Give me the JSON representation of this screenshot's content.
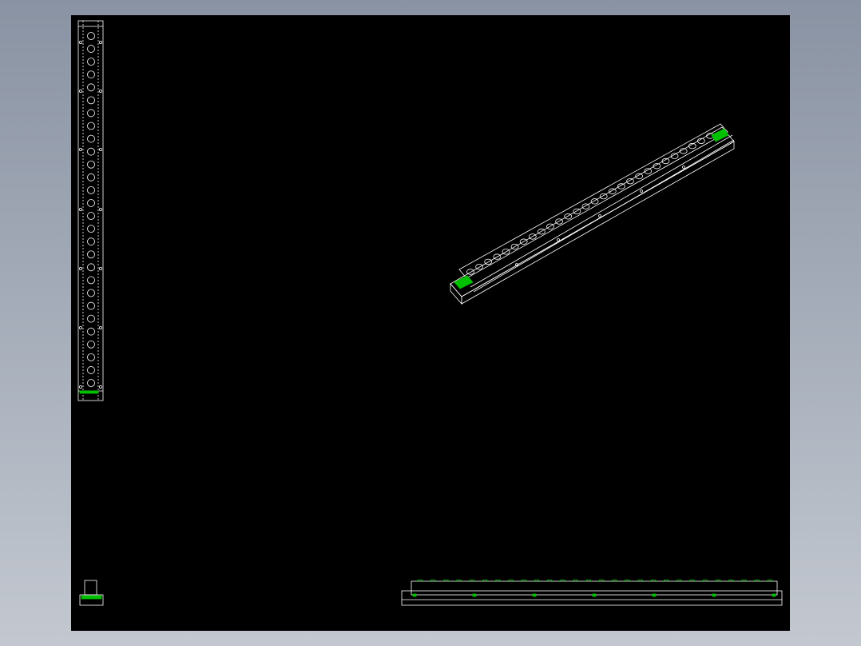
{
  "drawing": {
    "background": "#000000",
    "line_color": "#ffffff",
    "feature_color": "#00c000",
    "annotation_color": "#ff00ff",
    "views": [
      "top-view",
      "isometric-view",
      "front-view",
      "side-view"
    ],
    "hole_count": 28
  },
  "title_block": {
    "label_left": "",
    "label_right": ""
  }
}
